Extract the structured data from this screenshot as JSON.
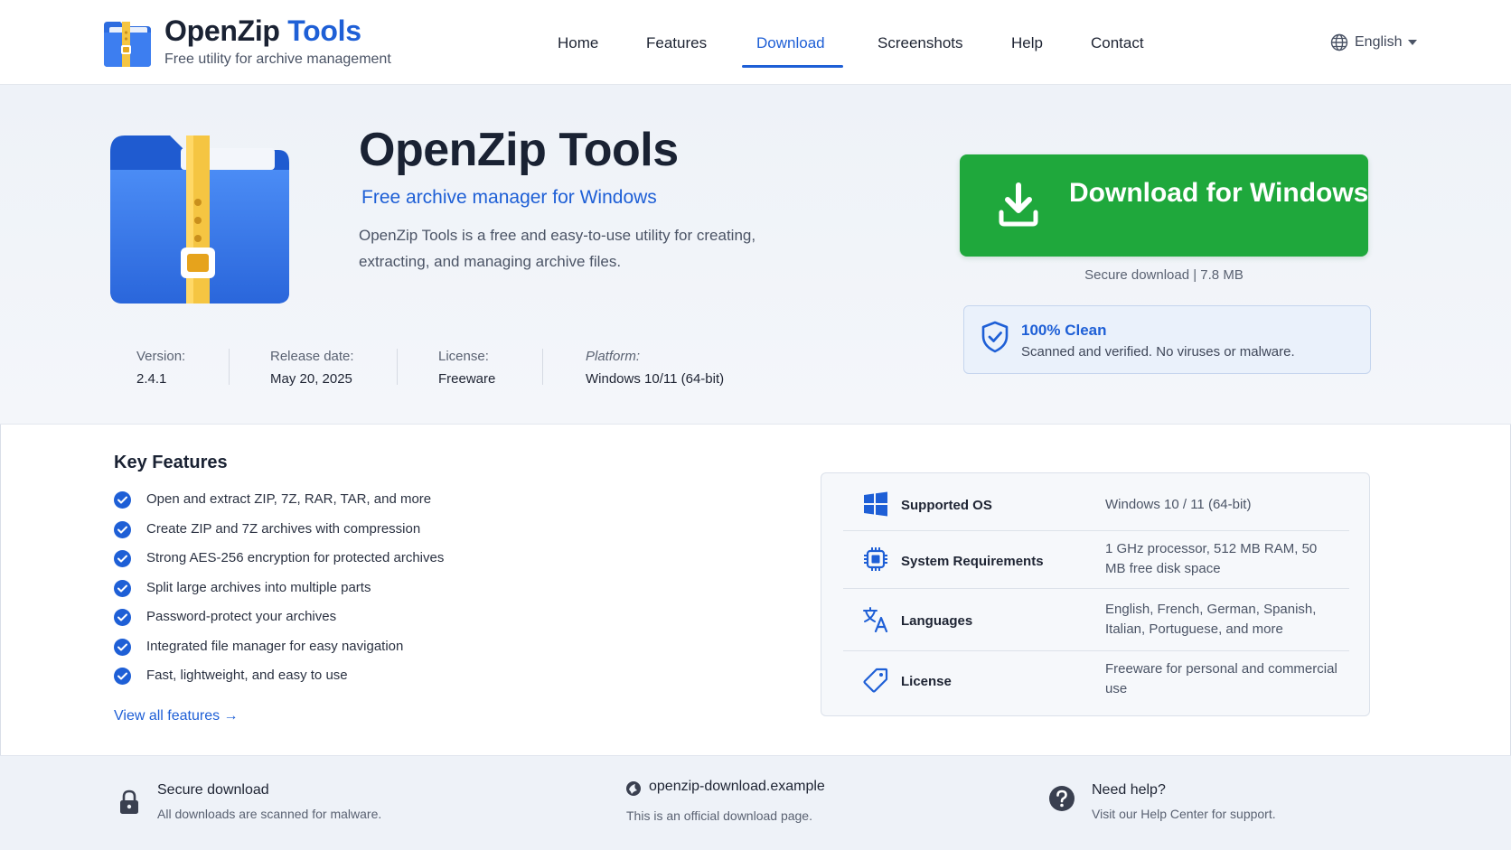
{
  "header": {
    "brand_name": "OpenZip",
    "brand_accent": "Tools",
    "tagline": "Free utility for archive management",
    "nav": [
      {
        "label": "Home"
      },
      {
        "label": "Features"
      },
      {
        "label": "Download"
      },
      {
        "label": "Screenshots"
      },
      {
        "label": "Help"
      },
      {
        "label": "Contact"
      }
    ],
    "active_nav": "Download",
    "language": "English"
  },
  "hero": {
    "title": "OpenZip Tools",
    "subtitle": "Free archive manager for Windows",
    "description": "OpenZip Tools is a free and easy-to-use utility for creating, extracting, and managing archive files.",
    "meta": [
      {
        "label": "Version:",
        "value": "2.4.1"
      },
      {
        "label": "Release date:",
        "value": "May 20, 2025"
      },
      {
        "label": "License:",
        "value": "Freeware"
      },
      {
        "label": "Platform:",
        "value": "Windows 10/11 (64-bit)"
      }
    ],
    "download_label": "Download for Windows",
    "download_note": "Secure download | 7.8 MB",
    "clean_title": "100% Clean",
    "clean_text": "Scanned and verified. No viruses or malware."
  },
  "features": {
    "title": "Key Features",
    "items": [
      "Open and extract ZIP, 7Z, RAR, TAR, and more",
      "Create ZIP and 7Z archives with compression",
      "Strong AES-256 encryption for protected archives",
      "Split large archives into multiple parts",
      "Password-protect your archives",
      "Integrated file manager for easy navigation",
      "Fast, lightweight, and easy to use"
    ],
    "view_all": "View all features →"
  },
  "specs": [
    {
      "icon": "windows-icon",
      "label": "Supported OS",
      "value": "Windows 10 / 11 (64-bit)"
    },
    {
      "icon": "cpu-chip-icon",
      "label": "System Requirements",
      "value": "1 GHz processor, 512 MB RAM, 50 MB free disk space"
    },
    {
      "icon": "translate-icon",
      "label": "Languages",
      "value": "English, French, German, Spanish, Italian, Portuguese, and more"
    },
    {
      "icon": "tag-icon",
      "label": "License",
      "value": "Freeware for personal and commercial use"
    }
  ],
  "footer": {
    "secure_title": "Secure download",
    "secure_text": "All downloads are scanned for malware.",
    "domain_title": "openzip-download.example",
    "domain_text": "This is an official download page.",
    "help_title": "Need help?",
    "help_text": "Visit our Help Center for support."
  },
  "colors": {
    "accent": "#1e5fd6",
    "download_green": "#1fa83c",
    "zipper_yellow": "#f5c542"
  }
}
